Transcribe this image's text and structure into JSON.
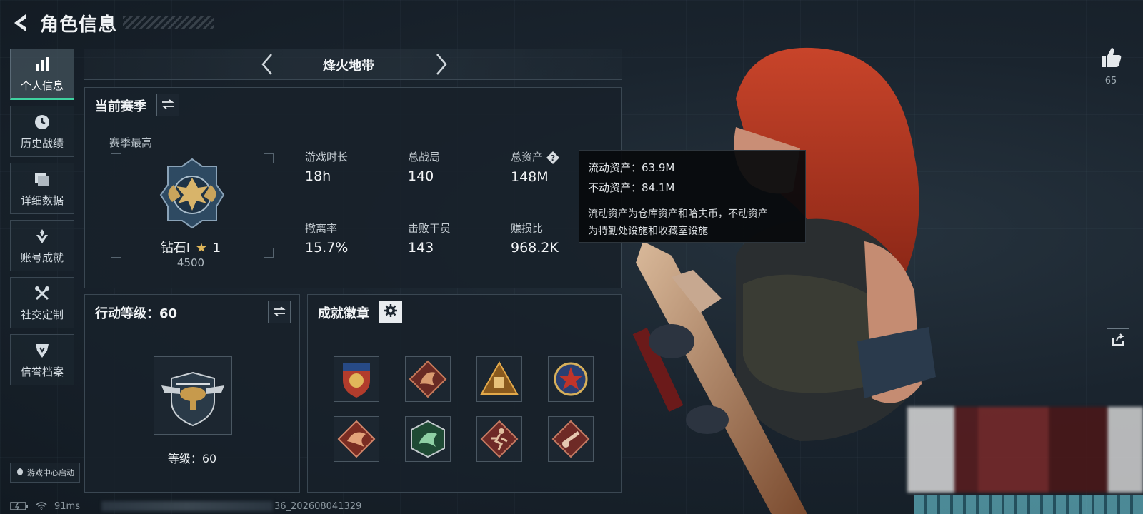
{
  "header": {
    "title": "角色信息"
  },
  "sidebar": {
    "items": [
      {
        "label": "个人信息",
        "icon": "bar-chart-icon",
        "active": true
      },
      {
        "label": "历史战绩",
        "icon": "history-clock-icon",
        "active": false
      },
      {
        "label": "详细数据",
        "icon": "folder-icon",
        "active": false
      },
      {
        "label": "账号成就",
        "icon": "achievement-icon",
        "active": false
      },
      {
        "label": "社交定制",
        "icon": "tools-icon",
        "active": false
      },
      {
        "label": "信誉档案",
        "icon": "shield-down-icon",
        "active": false
      }
    ],
    "game_center": "游戏中心启动"
  },
  "mode": {
    "name": "烽火地带"
  },
  "season": {
    "title": "当前赛季",
    "best_label": "赛季最高",
    "rank": "钻石I",
    "rank_stars": "1",
    "rank_score": "4500",
    "stats": [
      {
        "label": "游戏时长",
        "value": "18h"
      },
      {
        "label": "总战局",
        "value": "140"
      },
      {
        "label": "总资产",
        "value": "148M"
      },
      {
        "label": "撤离率",
        "value": "15.7%"
      },
      {
        "label": "击败干员",
        "value": "143"
      },
      {
        "label": "赚损比",
        "value": "968.2K"
      }
    ]
  },
  "tooltip": {
    "liquid": "流动资产：63.9M",
    "fixed": "不动资产：84.1M",
    "desc_line1": "流动资产为仓库资产和哈夫币，不动资产",
    "desc_line2": "为特勤处设施和收藏室设施"
  },
  "action_level": {
    "title": "行动等级：60",
    "level_text": "等级：60"
  },
  "achievements": {
    "title": "成就徽章",
    "badges": [
      "eagle-shield-badge",
      "dragon-diamond-badge",
      "triangle-crate-badge",
      "star-crest-badge",
      "dragon-diamond-badge-2",
      "green-dragon-badge",
      "runner-diamond-badge",
      "cannon-diamond-badge"
    ]
  },
  "social": {
    "likes": "65"
  },
  "status": {
    "ping": "91ms",
    "build_suffix": "36_202608041329"
  },
  "colors": {
    "accent": "#3fd2a0",
    "panel_border": "#3a4752",
    "bg": "#16202a"
  }
}
